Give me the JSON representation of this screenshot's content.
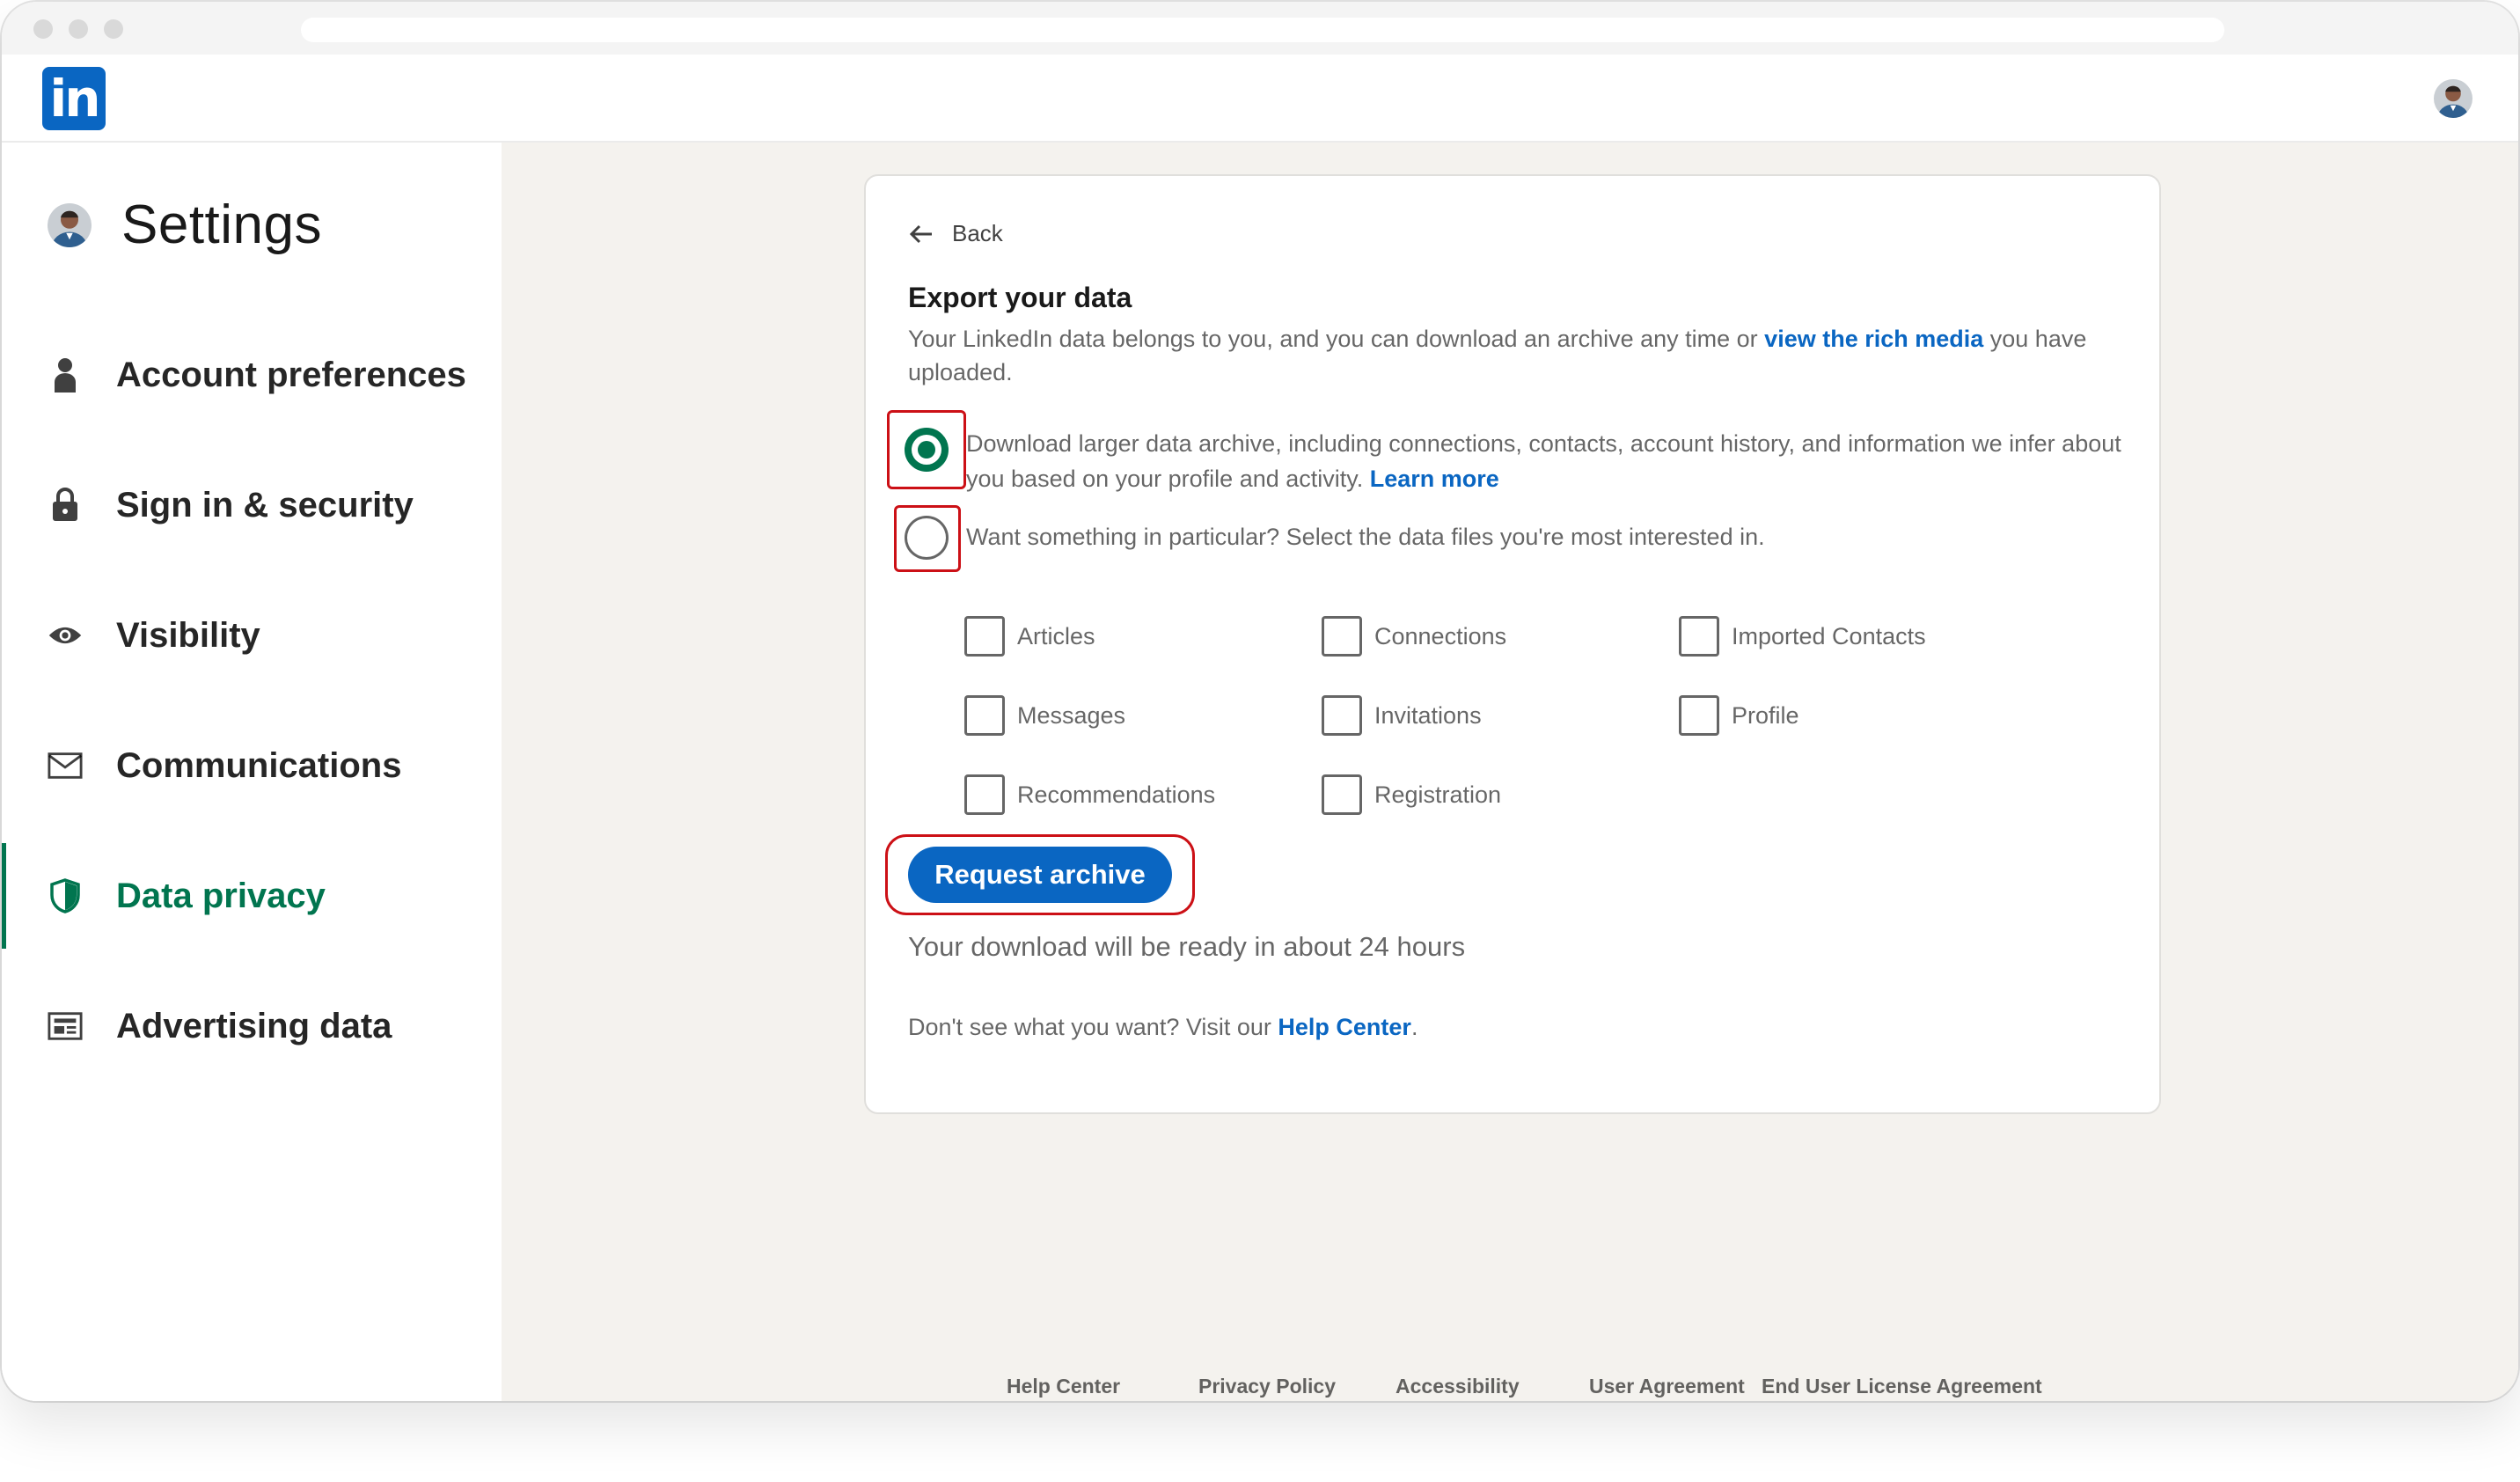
{
  "header": {
    "logo_text": "in",
    "brand_color": "#0a66c2"
  },
  "sidebar": {
    "title": "Settings",
    "accent_color": "#01754f",
    "items": [
      {
        "label": "Account preferences",
        "icon": "person-icon",
        "active": false
      },
      {
        "label": "Sign in & security",
        "icon": "lock-icon",
        "active": false
      },
      {
        "label": "Visibility",
        "icon": "eye-icon",
        "active": false
      },
      {
        "label": "Communications",
        "icon": "envelope-icon",
        "active": false
      },
      {
        "label": "Data privacy",
        "icon": "shield-icon",
        "active": true
      },
      {
        "label": "Advertising data",
        "icon": "newspaper-icon",
        "active": false
      }
    ]
  },
  "card": {
    "back_label": "Back",
    "title": "Export your data",
    "desc_before": "Your LinkedIn data belongs to you, and you can download an archive any time or ",
    "desc_link": "view the rich media",
    "desc_after": " you have uploaded.",
    "options": [
      {
        "text": "Download larger data archive, including connections, contacts, account history, and information we infer about you based on your profile and activity. ",
        "link": "Learn more",
        "checked": true
      },
      {
        "text": "Want something in particular? Select the data files you're most interested in.",
        "checked": false
      }
    ],
    "checkboxes": [
      [
        "Articles",
        "Connections",
        "Imported Contacts"
      ],
      [
        "Messages",
        "Invitations",
        "Profile"
      ],
      [
        "Recommendations",
        "Registration"
      ]
    ],
    "request_button": "Request archive",
    "ready_text": "Your download will be ready in about 24 hours",
    "help_before": "Don't see what you want? Visit our ",
    "help_link": "Help Center",
    "help_after": "."
  },
  "footer": {
    "links": [
      "Help Center",
      "Privacy Policy",
      "Accessibility",
      "User Agreement",
      "End User License Agreement"
    ]
  }
}
